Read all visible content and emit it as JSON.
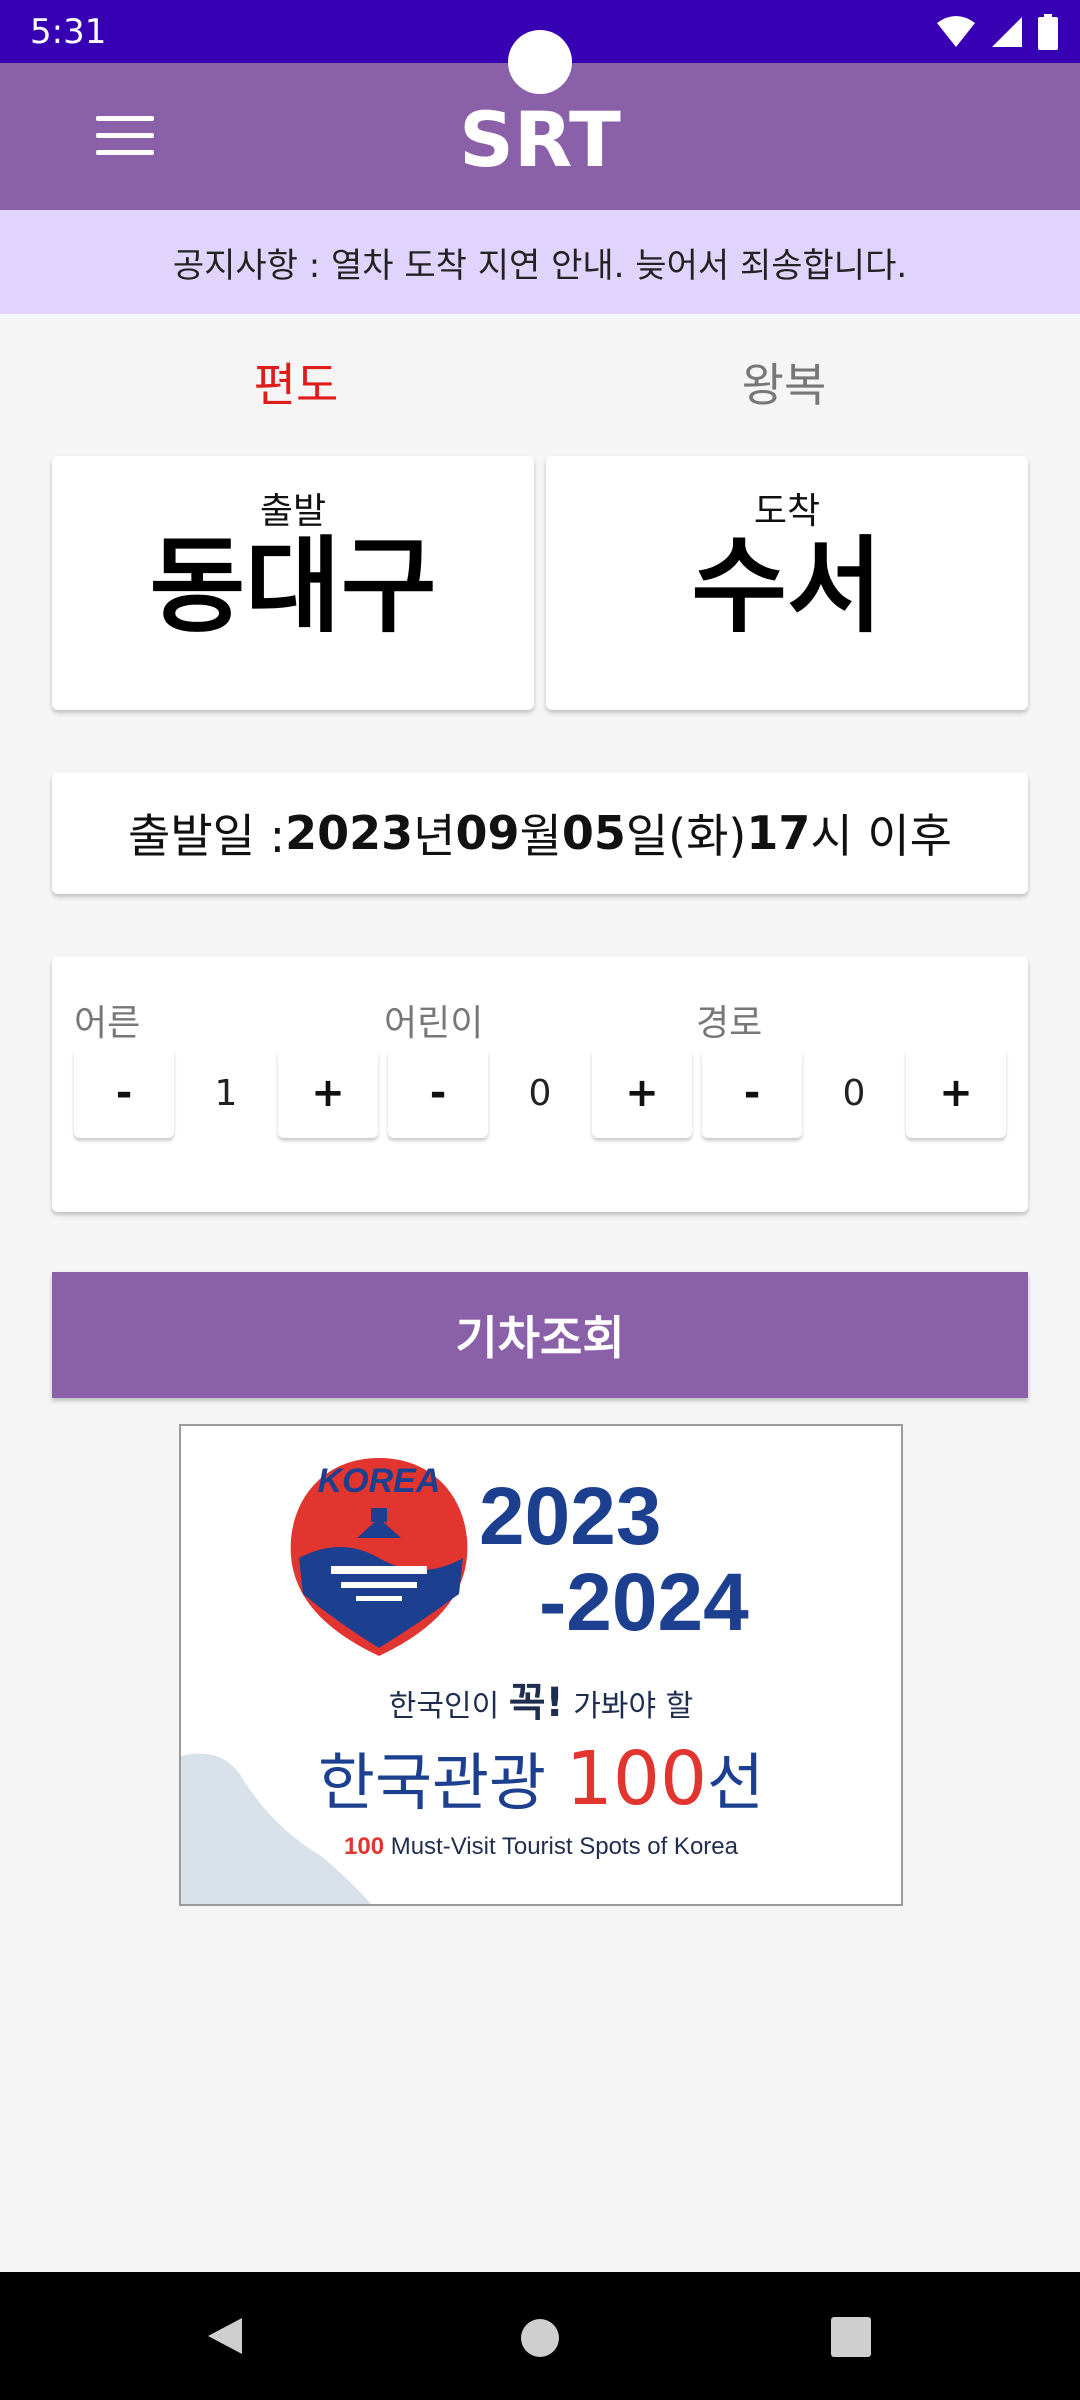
{
  "status_bar": {
    "time": "5:31"
  },
  "app_bar": {
    "title": "SRT"
  },
  "notice": {
    "text": "공지사항 : 열차 도착 지연 안내. 늦어서 죄송합니다."
  },
  "tabs": {
    "one_way": "편도",
    "round_trip": "왕복"
  },
  "departure": {
    "label": "출발",
    "station": "동대구"
  },
  "arrival": {
    "label": "도착",
    "station": "수서"
  },
  "date": {
    "prefix": "출발일 : ",
    "year": "2023",
    "year_unit": "년 ",
    "month": "09",
    "month_unit": "월 ",
    "day": "05",
    "day_unit": "일(화) ",
    "hour": "17",
    "hour_unit": "시 이후"
  },
  "passengers": {
    "minus": "-",
    "plus": "+",
    "adult": {
      "label": "어른",
      "count": "1"
    },
    "child": {
      "label": "어린이",
      "count": "0"
    },
    "senior": {
      "label": "경로",
      "count": "0"
    }
  },
  "search_button": "기차조회",
  "banner": {
    "year_line1": "2023",
    "year_line2": "-2024",
    "tagline_prefix": "한국인이 ",
    "tagline_emph": "꼭!",
    "tagline_suffix": " 가봐야 할",
    "title_prefix": "한국관광 ",
    "title_num": "100",
    "title_suffix": "선",
    "subtitle_num": "100",
    "subtitle": " Must-Visit Tourist Spots of Korea",
    "logo_text": "KOREA"
  },
  "colors": {
    "status_bar": "#3700b3",
    "primary": "#8a60a8",
    "notice_bg": "#e0d4fc",
    "active_tab": "#e01b1b",
    "banner_blue": "#1d3f8f",
    "banner_red": "#e2352f"
  }
}
